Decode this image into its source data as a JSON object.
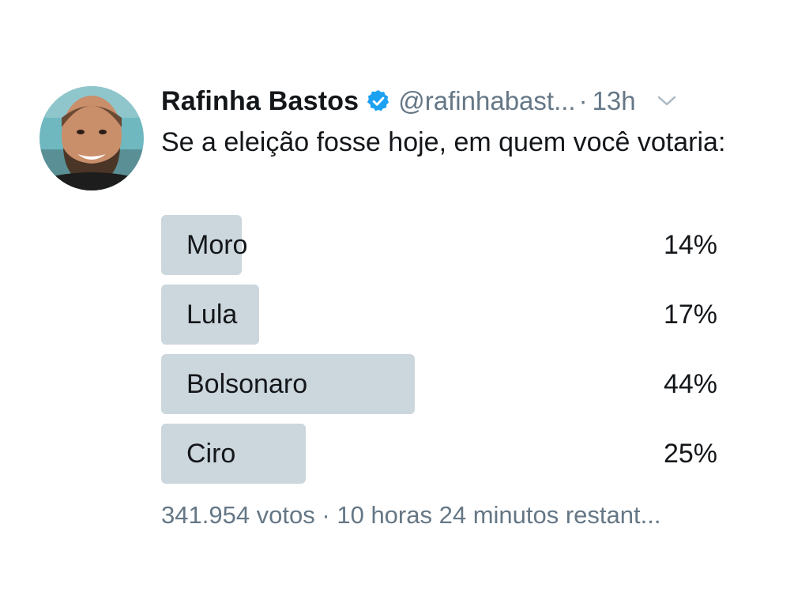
{
  "tweet": {
    "author_name": "Rafinha Bastos",
    "handle": "@rafinhabast...",
    "separator": "·",
    "time": "13h",
    "text": "Se a eleição fosse hoje, em quem você votaria:",
    "verified_icon": "verified-badge-icon",
    "menu_icon": "chevron-down-icon",
    "accent_color": "#1da1f2"
  },
  "poll": {
    "bar_color": "#ccd6dd",
    "options": [
      {
        "label": "Moro",
        "percent_text": "14%",
        "percent": 14
      },
      {
        "label": "Lula",
        "percent_text": "17%",
        "percent": 17
      },
      {
        "label": "Bolsonaro",
        "percent_text": "44%",
        "percent": 44
      },
      {
        "label": "Ciro",
        "percent_text": "25%",
        "percent": 25
      }
    ],
    "votes": "341.954 votos",
    "footer_separator": "·",
    "time_left": "10 horas 24 minutos restant..."
  }
}
